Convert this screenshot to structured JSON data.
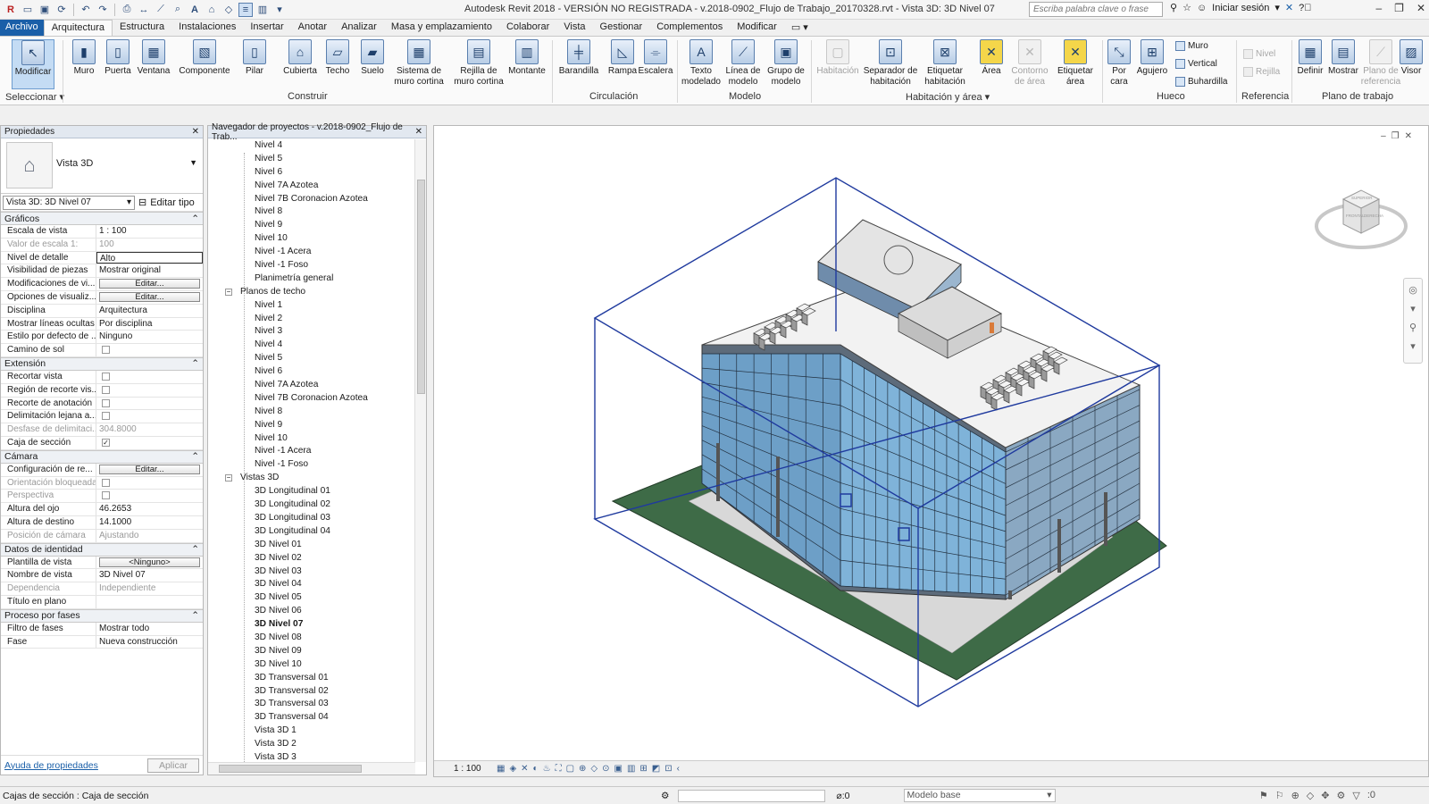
{
  "window": {
    "title": "Autodesk Revit 2018 - VERSIÓN NO REGISTRADA -     v.2018-0902_Flujo de Trabajo_20170328.rvt - Vista 3D: 3D Nivel 07",
    "search_placeholder": "Escriba palabra clave o frase",
    "signin": "Iniciar sesión"
  },
  "tabs": [
    "Archivo",
    "Arquitectura",
    "Estructura",
    "Instalaciones",
    "Insertar",
    "Anotar",
    "Analizar",
    "Masa y emplazamiento",
    "Colaborar",
    "Vista",
    "Gestionar",
    "Complementos",
    "Modificar"
  ],
  "ribbon": {
    "modify": "Modificar",
    "select_label": "Seleccionar ▾",
    "build": [
      "Muro",
      "Puerta",
      "Ventana",
      "Componente",
      "Pilar",
      "Cubierta",
      "Techo",
      "Suelo",
      "Sistema de muro cortina",
      "Rejilla de muro cortina",
      "Montante"
    ],
    "build_label": "Construir",
    "circ": [
      "Barandilla",
      "Rampa",
      "Escalera"
    ],
    "circ_label": "Circulación",
    "model": [
      "Texto modelado",
      "Línea de modelo",
      "Grupo de modelo"
    ],
    "model_label": "Modelo",
    "room": [
      "Habitación",
      "Separador de habitación",
      "Etiquetar habitación",
      "Área",
      "Contorno de área",
      "Etiquetar área"
    ],
    "room_label": "Habitación y área ▾",
    "opening": [
      "Por cara",
      "Agujero"
    ],
    "opening_small": [
      "Muro",
      "Vertical",
      "Buhardilla"
    ],
    "opening_label": "Hueco",
    "datum_small": [
      "Nivel",
      "Rejilla"
    ],
    "datum_label": "Referencia",
    "work": [
      "Definir",
      "Mostrar",
      "Plano de referencia",
      "Visor"
    ],
    "work_label": "Plano de trabajo"
  },
  "properties": {
    "header": "Propiedades",
    "type_name": "Vista 3D",
    "instance": "Vista 3D: 3D Nivel 07",
    "edit_type": "Editar tipo",
    "groups": [
      {
        "name": "Gráficos",
        "rows": [
          {
            "n": "Escala de vista",
            "v": "1 : 100"
          },
          {
            "n": "Valor de escala   1:",
            "v": "100",
            "ro": true
          },
          {
            "n": "Nivel de detalle",
            "v": "Alto",
            "boxed": true
          },
          {
            "n": "Visibilidad de piezas",
            "v": "Mostrar original"
          },
          {
            "n": "Modificaciones de vi...",
            "v": "Editar...",
            "btn": true
          },
          {
            "n": "Opciones de visualiz...",
            "v": "Editar...",
            "btn": true
          },
          {
            "n": "Disciplina",
            "v": "Arquitectura"
          },
          {
            "n": "Mostrar líneas ocultas",
            "v": "Por disciplina"
          },
          {
            "n": "Estilo por defecto de ...",
            "v": "Ninguno"
          },
          {
            "n": "Camino de sol",
            "v": "",
            "chk": true
          }
        ]
      },
      {
        "name": "Extensión",
        "rows": [
          {
            "n": "Recortar vista",
            "v": "",
            "chk": true
          },
          {
            "n": "Región de recorte vis...",
            "v": "",
            "chk": true
          },
          {
            "n": "Recorte de anotación",
            "v": "",
            "chk": true
          },
          {
            "n": "Delimitación lejana a...",
            "v": "",
            "chk": true
          },
          {
            "n": "Desfase de delimitaci...",
            "v": "304.8000",
            "ro": true
          },
          {
            "n": "Caja de sección",
            "v": "✓",
            "chk": true
          }
        ]
      },
      {
        "name": "Cámara",
        "rows": [
          {
            "n": "Configuración de re...",
            "v": "Editar...",
            "btn": true
          },
          {
            "n": "Orientación bloqueada",
            "v": "",
            "chk": true,
            "ro": true
          },
          {
            "n": "Perspectiva",
            "v": "",
            "chk": true,
            "ro": true
          },
          {
            "n": "Altura del ojo",
            "v": "46.2653"
          },
          {
            "n": "Altura de destino",
            "v": "14.1000"
          },
          {
            "n": "Posición de cámara",
            "v": "Ajustando",
            "ro": true
          }
        ]
      },
      {
        "name": "Datos de identidad",
        "rows": [
          {
            "n": "Plantilla de vista",
            "v": "<Ninguno>",
            "btn": true
          },
          {
            "n": "Nombre de vista",
            "v": "3D Nivel 07"
          },
          {
            "n": "Dependencia",
            "v": "Independiente",
            "ro": true
          },
          {
            "n": "Título en plano",
            "v": ""
          }
        ]
      },
      {
        "name": "Proceso por fases",
        "rows": [
          {
            "n": "Filtro de fases",
            "v": "Mostrar todo"
          },
          {
            "n": "Fase",
            "v": "Nueva construcción"
          }
        ]
      }
    ],
    "help_link": "Ayuda de propiedades",
    "apply": "Aplicar"
  },
  "browser": {
    "header": "Navegador de proyectos - v.2018-0902_Flujo de Trab...",
    "items": [
      {
        "t": "Nivel 4",
        "l": 2
      },
      {
        "t": "Nivel 5",
        "l": 2
      },
      {
        "t": "Nivel 6",
        "l": 2
      },
      {
        "t": "Nivel 7A Azotea",
        "l": 2
      },
      {
        "t": "Nivel 7B Coronacion Azotea",
        "l": 2
      },
      {
        "t": "Nivel 8",
        "l": 2
      },
      {
        "t": "Nivel 9",
        "l": 2
      },
      {
        "t": "Nivel 10",
        "l": 2
      },
      {
        "t": "Nivel -1 Acera",
        "l": 2
      },
      {
        "t": "Nivel -1 Foso",
        "l": 2
      },
      {
        "t": "Planimetría general",
        "l": 2
      },
      {
        "t": "Planos de techo",
        "l": 1
      },
      {
        "t": "Nivel 1",
        "l": 2
      },
      {
        "t": "Nivel 2",
        "l": 2
      },
      {
        "t": "Nivel 3",
        "l": 2
      },
      {
        "t": "Nivel 4",
        "l": 2
      },
      {
        "t": "Nivel 5",
        "l": 2
      },
      {
        "t": "Nivel 6",
        "l": 2
      },
      {
        "t": "Nivel 7A Azotea",
        "l": 2
      },
      {
        "t": "Nivel 7B Coronacion Azotea",
        "l": 2
      },
      {
        "t": "Nivel 8",
        "l": 2
      },
      {
        "t": "Nivel 9",
        "l": 2
      },
      {
        "t": "Nivel 10",
        "l": 2
      },
      {
        "t": "Nivel -1 Acera",
        "l": 2
      },
      {
        "t": "Nivel -1 Foso",
        "l": 2
      },
      {
        "t": "Vistas 3D",
        "l": 1
      },
      {
        "t": "3D Longitudinal 01",
        "l": 2
      },
      {
        "t": "3D Longitudinal 02",
        "l": 2
      },
      {
        "t": "3D Longitudinal 03",
        "l": 2
      },
      {
        "t": "3D Longitudinal 04",
        "l": 2
      },
      {
        "t": "3D Nivel 01",
        "l": 2
      },
      {
        "t": "3D Nivel 02",
        "l": 2
      },
      {
        "t": "3D Nivel 03",
        "l": 2
      },
      {
        "t": "3D Nivel 04",
        "l": 2
      },
      {
        "t": "3D Nivel 05",
        "l": 2
      },
      {
        "t": "3D Nivel 06",
        "l": 2
      },
      {
        "t": "3D Nivel 07",
        "l": 2,
        "bold": true
      },
      {
        "t": "3D Nivel 08",
        "l": 2
      },
      {
        "t": "3D Nivel 09",
        "l": 2
      },
      {
        "t": "3D Nivel 10",
        "l": 2
      },
      {
        "t": "3D Transversal 01",
        "l": 2
      },
      {
        "t": "3D Transversal 02",
        "l": 2
      },
      {
        "t": "3D Transversal 03",
        "l": 2
      },
      {
        "t": "3D Transversal 04",
        "l": 2
      },
      {
        "t": "Vista 3D 1",
        "l": 2
      },
      {
        "t": "Vista 3D 2",
        "l": 2
      },
      {
        "t": "Vista 3D 3",
        "l": 2
      }
    ]
  },
  "viewport": {
    "scale": "1 : 100",
    "viewcube_labels": [
      "SUPERIOR",
      "FRONTAL",
      "DERECHA"
    ]
  },
  "statusbar": {
    "text": "Cajas de sección : Caja de sección",
    "sel_count": ":0",
    "model": "Modelo base",
    "filter_count": ":0"
  },
  "colors": {
    "accent": "#1a5fa8",
    "section_box": "#1f3a9e",
    "glass": "#7fb3d9",
    "ground": "#3e6b47"
  }
}
